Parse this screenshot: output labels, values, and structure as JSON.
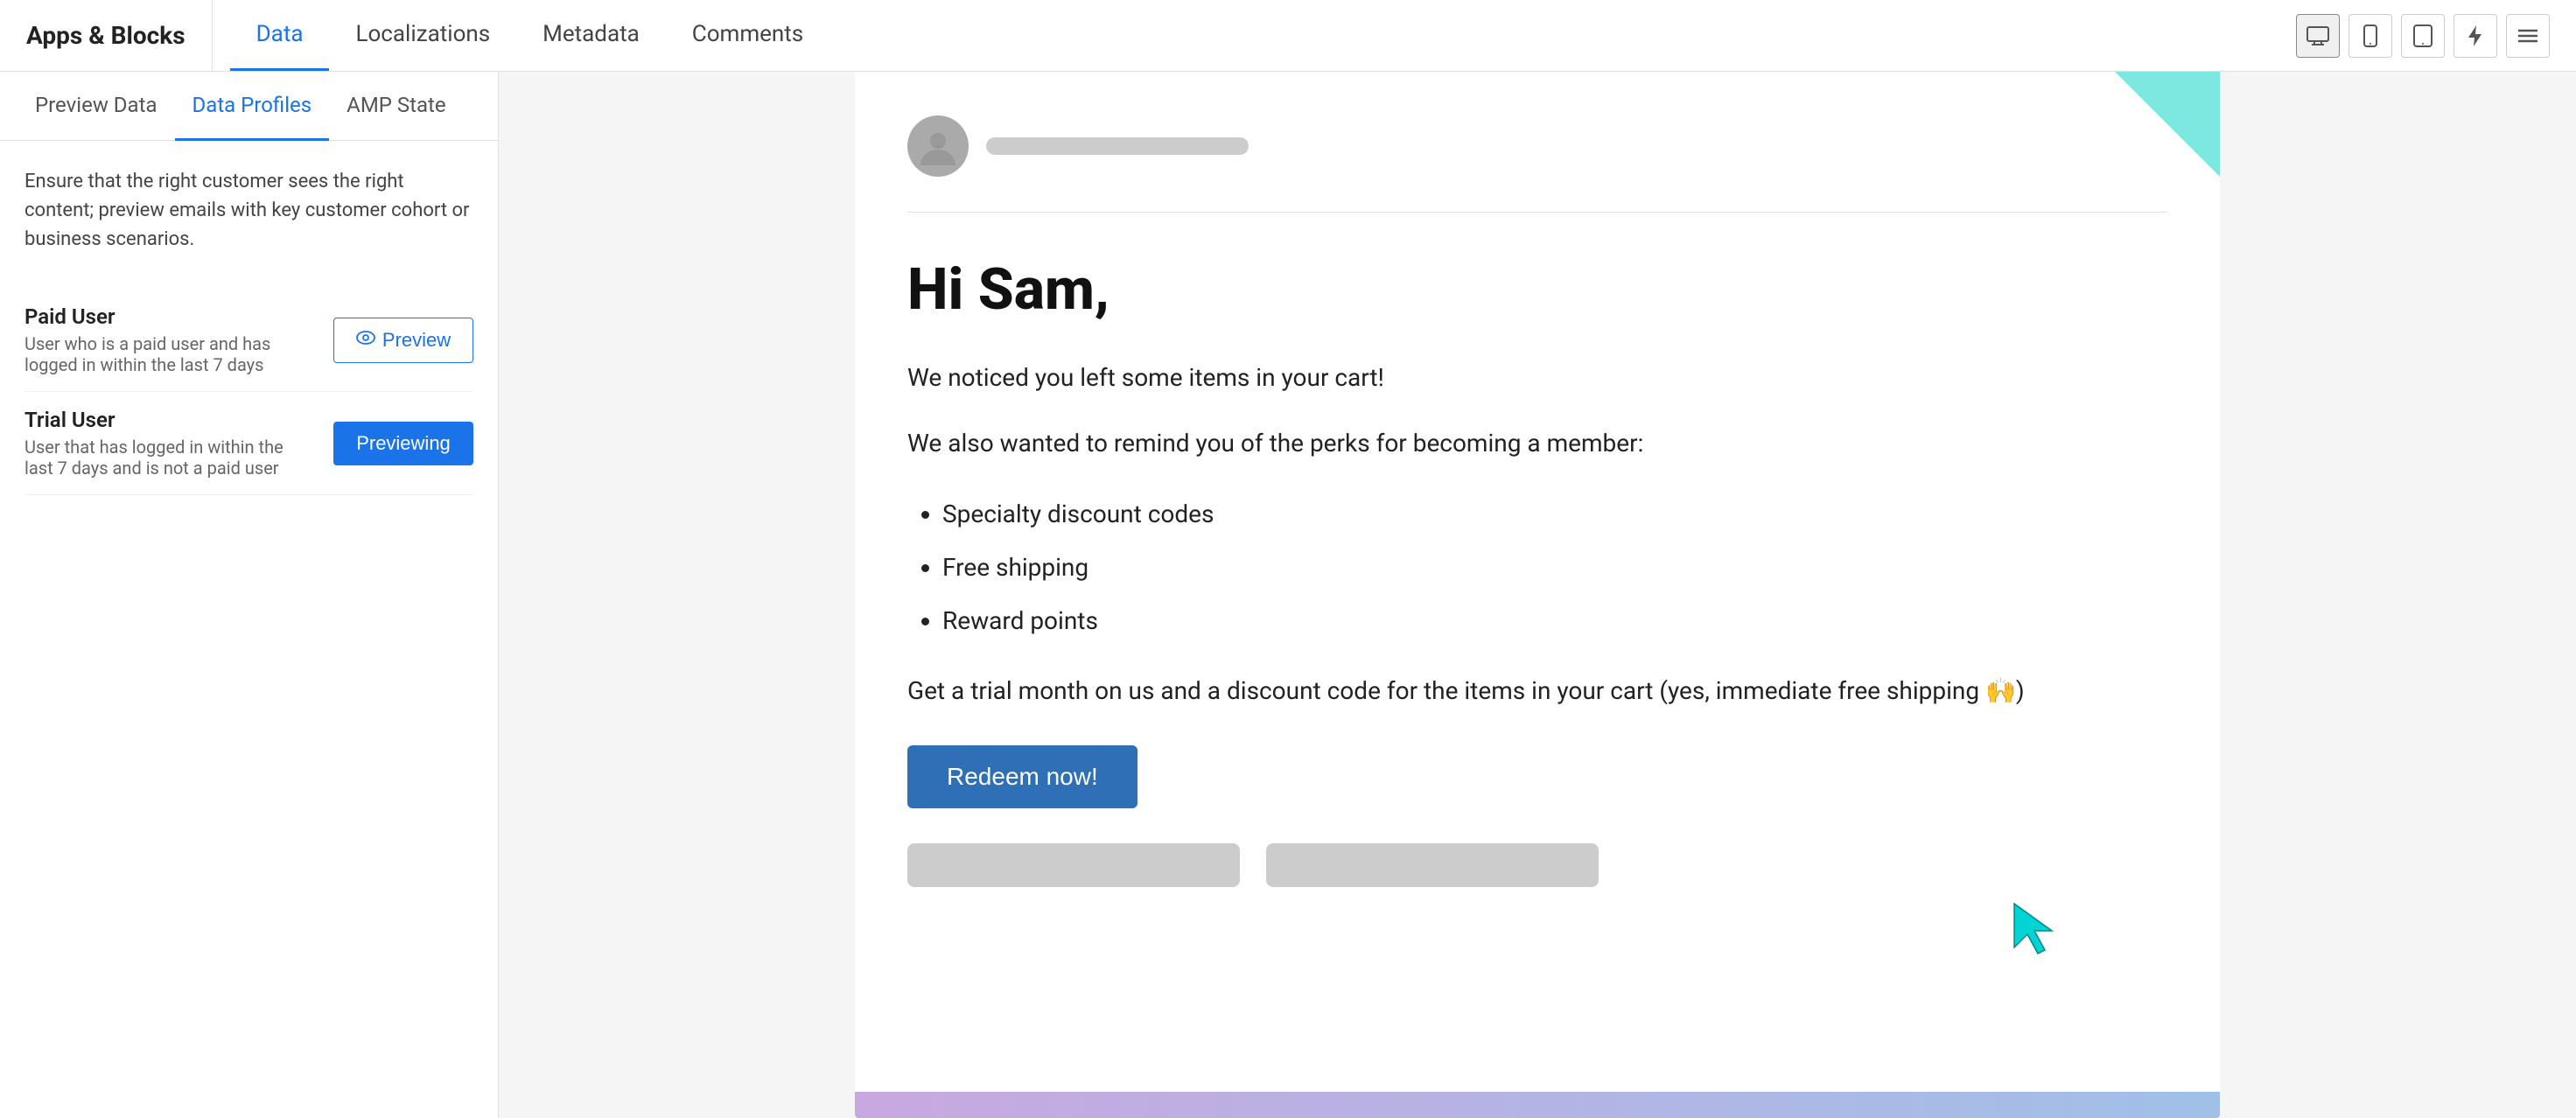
{
  "nav": {
    "logo": "Apps & Blocks",
    "tabs": [
      {
        "id": "data",
        "label": "Data",
        "active": true
      },
      {
        "id": "localizations",
        "label": "Localizations",
        "active": false
      },
      {
        "id": "metadata",
        "label": "Metadata",
        "active": false
      },
      {
        "id": "comments",
        "label": "Comments",
        "active": false
      }
    ],
    "icons": [
      {
        "id": "desktop",
        "symbol": "🖥",
        "active": true
      },
      {
        "id": "mobile",
        "symbol": "📱",
        "active": false
      },
      {
        "id": "tablet",
        "symbol": "⬜",
        "active": false
      },
      {
        "id": "flash",
        "symbol": "⚡",
        "active": false
      },
      {
        "id": "list",
        "symbol": "≡",
        "active": false
      }
    ]
  },
  "sub_tabs": [
    {
      "id": "preview-data",
      "label": "Preview Data",
      "active": false
    },
    {
      "id": "data-profiles",
      "label": "Data Profiles",
      "active": true
    },
    {
      "id": "amp-state",
      "label": "AMP State",
      "active": false
    }
  ],
  "description": "Ensure that the right customer sees the right content; preview emails with key customer cohort or business scenarios.",
  "profiles": [
    {
      "id": "paid-user",
      "name": "Paid User",
      "description": "User who is a paid user and has logged in within the last 7 days",
      "button_label": "Preview",
      "button_state": "preview"
    },
    {
      "id": "trial-user",
      "name": "Trial User",
      "description": "User that has logged in within the last 7 days and is not a paid user",
      "button_label": "Previewing",
      "button_state": "previewing"
    }
  ],
  "email_preview": {
    "greeting": "Hi Sam,",
    "paragraph1": "We noticed you left some items in your cart!",
    "paragraph2": "We also wanted to remind you of the perks for becoming a member:",
    "list_items": [
      "Specialty discount codes",
      "Free shipping",
      "Reward points"
    ],
    "paragraph3": "Get a trial month on us and a discount code for the items in your cart (yes, immediate free shipping 🙌)",
    "cta_label": "Redeem now!"
  },
  "icons": {
    "eye": "👁",
    "desktop": "🖥",
    "mobile": "📱",
    "flash": "⚡",
    "list": "☰"
  }
}
